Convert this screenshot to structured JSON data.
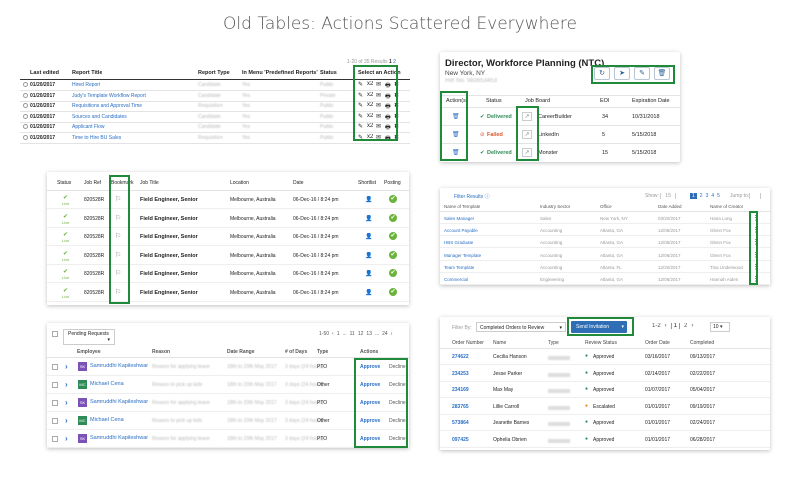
{
  "title": "Old Tables: Actions Scattered Everywhere",
  "p1": {
    "results": "1-20 of 35 Results",
    "pages": [
      "1",
      "2"
    ],
    "headers": [
      "Last edited",
      "Report Title",
      "Report Type",
      "In Menu 'Predefined Reports'",
      "Status",
      "Select an Action"
    ],
    "rows": [
      {
        "date": "01/20/2017",
        "title": "Hired Report",
        "type": "Candidate",
        "menu": "Yes",
        "status": "Public"
      },
      {
        "date": "01/20/2017",
        "title": "Judy's Template Workflow Report",
        "type": "Candidate",
        "menu": "Yes",
        "status": "Private"
      },
      {
        "date": "01/20/2017",
        "title": "Requisitions and Approval Time",
        "type": "Requisition",
        "menu": "Yes",
        "status": "Public"
      },
      {
        "date": "01/20/2017",
        "title": "Sources and Candidates",
        "type": "Candidate",
        "menu": "Yes",
        "status": "Public"
      },
      {
        "date": "01/20/2017",
        "title": "Applicant Flow",
        "type": "Candidate",
        "menu": "Yes",
        "status": "Public"
      },
      {
        "date": "01/20/2017",
        "title": "Time to Hire BU Sales",
        "type": "Requisition",
        "menu": "Yes",
        "status": "Public"
      }
    ],
    "action_icons": [
      "✎",
      "x2",
      "✉",
      "🖶",
      "✖"
    ]
  },
  "p2": {
    "job_title": "Director, Workforce Planning (NTC)",
    "location": "New York, NY",
    "ref": "Ref No. 983653453",
    "headers": [
      "Action(s)",
      "Status",
      "Job Board",
      "EOI",
      "Expiration Date"
    ],
    "rows": [
      {
        "status": "Delivered",
        "board": "CareerBuilder",
        "eoi": "34",
        "exp": "10/31/2018"
      },
      {
        "status": "Failed",
        "board": "LinkedIn",
        "eoi": "5",
        "exp": "5/15/2018"
      },
      {
        "status": "Delivered",
        "board": "Monster",
        "eoi": "15",
        "exp": "5/15/2018"
      }
    ],
    "toolbar_icons": [
      "↻",
      "➤",
      "✎",
      "🗑"
    ]
  },
  "p3": {
    "headers": [
      "Status",
      "Job Ref",
      "Bookmark",
      "Job Title",
      "Location",
      "Date",
      "Shortlist",
      "Posting"
    ],
    "status": "Live",
    "rows": [
      {
        "ref": "820528R",
        "title": "Field Engineer, Senior",
        "loc": "Melbourne, Australia",
        "date": "06-Dec-16 / 8:24 pm"
      },
      {
        "ref": "820528R",
        "title": "Field Engineer, Senior",
        "loc": "Melbourne, Australia",
        "date": "06-Dec-16 / 8:24 pm"
      },
      {
        "ref": "820528R",
        "title": "Field Engineer, Senior",
        "loc": "Melbourne, Australia",
        "date": "06-Dec-16 / 8:24 pm"
      },
      {
        "ref": "820528R",
        "title": "Field Engineer, Senior",
        "loc": "Melbourne, Australia",
        "date": "06-Dec-16 / 8:24 pm"
      },
      {
        "ref": "820528R",
        "title": "Field Engineer, Senior",
        "loc": "Melbourne, Australia",
        "date": "06-Dec-16 / 8:24 pm"
      },
      {
        "ref": "820528R",
        "title": "Field Engineer, Senior",
        "loc": "Melbourne, Australia",
        "date": "06-Dec-16 / 8:24 pm"
      }
    ]
  },
  "p4": {
    "filter": "Filter Results",
    "show_label": "Show:",
    "show_value": "15",
    "jump_label": "Jump to:",
    "pages": [
      "1",
      "2",
      "3",
      "4",
      "5"
    ],
    "headers": [
      "Name of Template",
      "Industry Sector",
      "Office",
      "Date Added",
      "Name of Creator"
    ],
    "rows": [
      {
        "name": "Sales Manager",
        "sector": "Sales",
        "office": "New York, NY",
        "date": "03/20/2017",
        "creator": "Hana Long"
      },
      {
        "name": "Account Payable",
        "sector": "Accounting",
        "office": "Atlanta, GA",
        "date": "12/06/2017",
        "creator": "Glenn Fox"
      },
      {
        "name": "HBS Graduate",
        "sector": "Accounting",
        "office": "Atlanta, GA",
        "date": "12/06/2017",
        "creator": "Glenn Fox"
      },
      {
        "name": "Manager Template",
        "sector": "Accounting",
        "office": "Atlanta, GA",
        "date": "12/06/2017",
        "creator": "Glenn Fox"
      },
      {
        "name": "Team Template",
        "sector": "Accounting",
        "office": "Atlanta, FL",
        "date": "12/20/2017",
        "creator": "Tina Underwood"
      },
      {
        "name": "Commercial",
        "sector": "Engineering",
        "office": "Atlanta, GA",
        "date": "12/06/2017",
        "creator": "Hannah Aiden"
      }
    ]
  },
  "p5": {
    "filter": "Pending Requests",
    "pagination": [
      "1-50",
      "‹",
      "1",
      "...",
      "11",
      "12",
      "13",
      "...",
      "24",
      "›"
    ],
    "headers": [
      "Employee",
      "Reason",
      "Date Range",
      "# of Days",
      "Type",
      "Actions"
    ],
    "rows": [
      {
        "initials": "SK",
        "name": "Samruddhi Kapileshwar",
        "reason": "Reason for applying leave",
        "range": "18th to 20th May 2017",
        "days": "3 days (24 hours)",
        "type": "PTO",
        "approve": "Approve",
        "decline": "Decline",
        "color": "#7b52b8"
      },
      {
        "initials": "MC",
        "name": "Michael Cena",
        "reason": "Reason to pick up kids",
        "range": "18th to 20th May 2017",
        "days": "3 days (24 hours)",
        "type": "Other",
        "approve": "Approve",
        "decline": "Decline",
        "color": "#2e8b57"
      },
      {
        "initials": "SK",
        "name": "Samruddhi Kapileshwar",
        "reason": "Reason for applying leave",
        "range": "18th to 20th May 2017",
        "days": "3 days (24 hours)",
        "type": "PTO",
        "approve": "Approve",
        "decline": "Decline",
        "color": "#7b52b8"
      },
      {
        "initials": "MC",
        "name": "Michael Cena",
        "reason": "Reason to pick up kids",
        "range": "18th to 20th May 2017",
        "days": "3 days (24 hours)",
        "type": "Other",
        "approve": "Approve",
        "decline": "Decline",
        "color": "#2e8b57"
      },
      {
        "initials": "SK",
        "name": "Samruddhi Kapileshwar",
        "reason": "Reason for applying leave",
        "range": "18th to 20th May 2017",
        "days": "3 days (24 hours)",
        "type": "PTO",
        "approve": "Approve",
        "decline": "Decline",
        "color": "#7b52b8"
      }
    ]
  },
  "p6": {
    "filter_label": "Filter By:",
    "filter_value": "Completed Orders to Review",
    "send": "Send Invitation",
    "pages": [
      "1-2",
      "‹",
      "1",
      "2",
      "›"
    ],
    "per_page": "10",
    "headers": [
      "Order Number",
      "Name",
      "Type",
      "Review Status",
      "Order Date",
      "Completed"
    ],
    "rows": [
      {
        "num": "274622",
        "name": "Cecilia Hanson",
        "status": "Approved",
        "sc": "#2e8b57",
        "date": "03/16/2017",
        "done": "09/13/2017"
      },
      {
        "num": "234253",
        "name": "Jesse Parker",
        "status": "Approved",
        "sc": "#2e8b57",
        "date": "02/14/2017",
        "done": "02/22/2017"
      },
      {
        "num": "234169",
        "name": "Max May",
        "status": "Approved",
        "sc": "#2e8b57",
        "date": "01/07/2017",
        "done": "05/04/2017"
      },
      {
        "num": "283765",
        "name": "Lillie Carroll",
        "status": "Escalated",
        "sc": "#e08a1e",
        "date": "01/01/2017",
        "done": "09/19/2017"
      },
      {
        "num": "573864",
        "name": "Jeanette Barnes",
        "status": "Approved",
        "sc": "#2e8b57",
        "date": "01/01/2017",
        "done": "02/24/2017"
      },
      {
        "num": "097425",
        "name": "Ophelia Obrien",
        "status": "Approved",
        "sc": "#2e8b57",
        "date": "01/01/2017",
        "done": "06/28/2017"
      }
    ]
  },
  "colors": {
    "accent_green": "#1f8a3a",
    "link": "#2a6fc4",
    "send_btn": "#2f6db5"
  }
}
